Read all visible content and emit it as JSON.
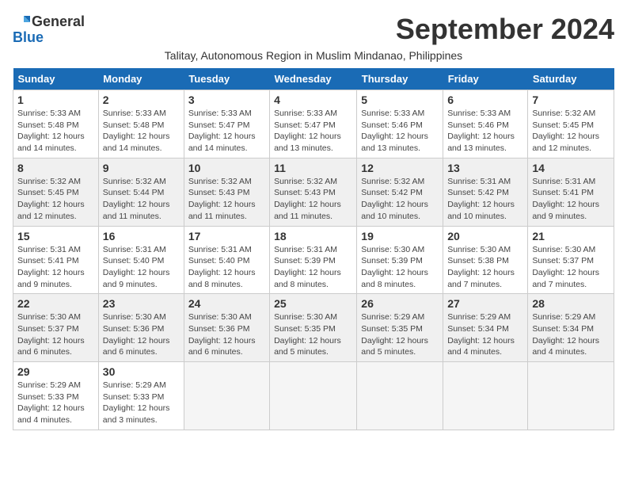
{
  "logo": {
    "general": "General",
    "blue": "Blue"
  },
  "title": "September 2024",
  "location": "Talitay, Autonomous Region in Muslim Mindanao, Philippines",
  "columns": [
    "Sunday",
    "Monday",
    "Tuesday",
    "Wednesday",
    "Thursday",
    "Friday",
    "Saturday"
  ],
  "weeks": [
    [
      {
        "day": "1",
        "info": "Sunrise: 5:33 AM\nSunset: 5:48 PM\nDaylight: 12 hours\nand 14 minutes."
      },
      {
        "day": "2",
        "info": "Sunrise: 5:33 AM\nSunset: 5:48 PM\nDaylight: 12 hours\nand 14 minutes."
      },
      {
        "day": "3",
        "info": "Sunrise: 5:33 AM\nSunset: 5:47 PM\nDaylight: 12 hours\nand 14 minutes."
      },
      {
        "day": "4",
        "info": "Sunrise: 5:33 AM\nSunset: 5:47 PM\nDaylight: 12 hours\nand 13 minutes."
      },
      {
        "day": "5",
        "info": "Sunrise: 5:33 AM\nSunset: 5:46 PM\nDaylight: 12 hours\nand 13 minutes."
      },
      {
        "day": "6",
        "info": "Sunrise: 5:33 AM\nSunset: 5:46 PM\nDaylight: 12 hours\nand 13 minutes."
      },
      {
        "day": "7",
        "info": "Sunrise: 5:32 AM\nSunset: 5:45 PM\nDaylight: 12 hours\nand 12 minutes."
      }
    ],
    [
      {
        "day": "8",
        "info": "Sunrise: 5:32 AM\nSunset: 5:45 PM\nDaylight: 12 hours\nand 12 minutes."
      },
      {
        "day": "9",
        "info": "Sunrise: 5:32 AM\nSunset: 5:44 PM\nDaylight: 12 hours\nand 11 minutes."
      },
      {
        "day": "10",
        "info": "Sunrise: 5:32 AM\nSunset: 5:43 PM\nDaylight: 12 hours\nand 11 minutes."
      },
      {
        "day": "11",
        "info": "Sunrise: 5:32 AM\nSunset: 5:43 PM\nDaylight: 12 hours\nand 11 minutes."
      },
      {
        "day": "12",
        "info": "Sunrise: 5:32 AM\nSunset: 5:42 PM\nDaylight: 12 hours\nand 10 minutes."
      },
      {
        "day": "13",
        "info": "Sunrise: 5:31 AM\nSunset: 5:42 PM\nDaylight: 12 hours\nand 10 minutes."
      },
      {
        "day": "14",
        "info": "Sunrise: 5:31 AM\nSunset: 5:41 PM\nDaylight: 12 hours\nand 9 minutes."
      }
    ],
    [
      {
        "day": "15",
        "info": "Sunrise: 5:31 AM\nSunset: 5:41 PM\nDaylight: 12 hours\nand 9 minutes."
      },
      {
        "day": "16",
        "info": "Sunrise: 5:31 AM\nSunset: 5:40 PM\nDaylight: 12 hours\nand 9 minutes."
      },
      {
        "day": "17",
        "info": "Sunrise: 5:31 AM\nSunset: 5:40 PM\nDaylight: 12 hours\nand 8 minutes."
      },
      {
        "day": "18",
        "info": "Sunrise: 5:31 AM\nSunset: 5:39 PM\nDaylight: 12 hours\nand 8 minutes."
      },
      {
        "day": "19",
        "info": "Sunrise: 5:30 AM\nSunset: 5:39 PM\nDaylight: 12 hours\nand 8 minutes."
      },
      {
        "day": "20",
        "info": "Sunrise: 5:30 AM\nSunset: 5:38 PM\nDaylight: 12 hours\nand 7 minutes."
      },
      {
        "day": "21",
        "info": "Sunrise: 5:30 AM\nSunset: 5:37 PM\nDaylight: 12 hours\nand 7 minutes."
      }
    ],
    [
      {
        "day": "22",
        "info": "Sunrise: 5:30 AM\nSunset: 5:37 PM\nDaylight: 12 hours\nand 6 minutes."
      },
      {
        "day": "23",
        "info": "Sunrise: 5:30 AM\nSunset: 5:36 PM\nDaylight: 12 hours\nand 6 minutes."
      },
      {
        "day": "24",
        "info": "Sunrise: 5:30 AM\nSunset: 5:36 PM\nDaylight: 12 hours\nand 6 minutes."
      },
      {
        "day": "25",
        "info": "Sunrise: 5:30 AM\nSunset: 5:35 PM\nDaylight: 12 hours\nand 5 minutes."
      },
      {
        "day": "26",
        "info": "Sunrise: 5:29 AM\nSunset: 5:35 PM\nDaylight: 12 hours\nand 5 minutes."
      },
      {
        "day": "27",
        "info": "Sunrise: 5:29 AM\nSunset: 5:34 PM\nDaylight: 12 hours\nand 4 minutes."
      },
      {
        "day": "28",
        "info": "Sunrise: 5:29 AM\nSunset: 5:34 PM\nDaylight: 12 hours\nand 4 minutes."
      }
    ],
    [
      {
        "day": "29",
        "info": "Sunrise: 5:29 AM\nSunset: 5:33 PM\nDaylight: 12 hours\nand 4 minutes."
      },
      {
        "day": "30",
        "info": "Sunrise: 5:29 AM\nSunset: 5:33 PM\nDaylight: 12 hours\nand 3 minutes."
      },
      null,
      null,
      null,
      null,
      null
    ]
  ]
}
